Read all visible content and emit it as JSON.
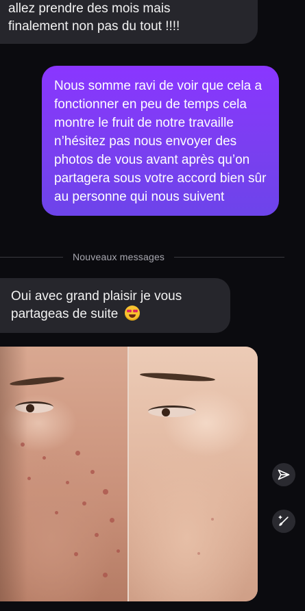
{
  "messages": {
    "prev_incoming_line1": "allez prendre des mois mais",
    "prev_incoming_line2": "finalement non pas du tout !!!!",
    "outgoing": "Nous somme ravi de voir que cela a fonctionner en peu de temps cela montre le fruit de notre travaille n’hésitez pas nous envoyer des photos de vous avant après qu’on partagera sous votre accord bien sûr au personne qui nous suivent",
    "divider": "Nouveaux messages",
    "reply_line1": "Oui avec grand plaisir je vous",
    "reply_line2": "partageas de suite"
  },
  "icons": {
    "reply_emoji": "smiling-face-with-heart-eyes-emoji",
    "send": "paper-plane-icon",
    "edit": "magic-brush-icon"
  },
  "colors": {
    "background": "#0b0b0f",
    "incoming_bubble": "#26262c",
    "outgoing_bubble_top": "#8a36ff",
    "outgoing_bubble_bottom": "#6d44ea",
    "divider_text": "#a8a8b0"
  }
}
